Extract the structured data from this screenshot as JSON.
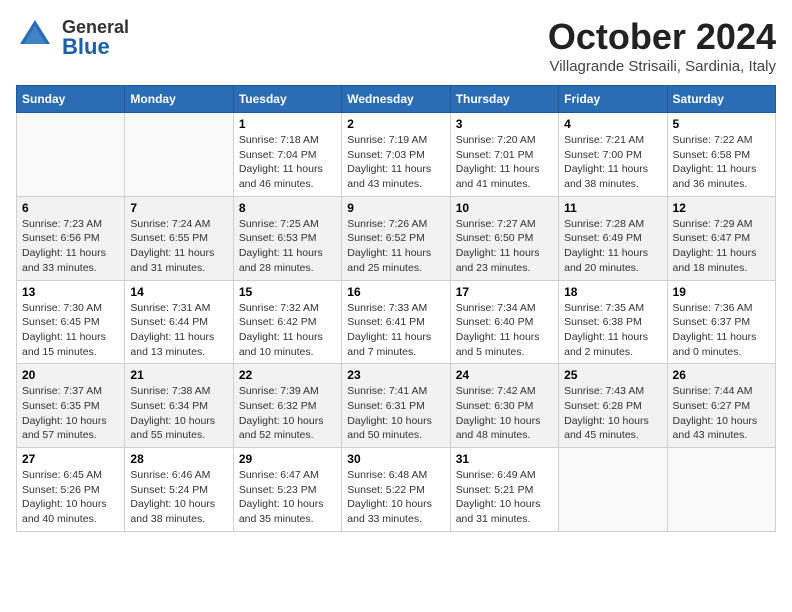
{
  "header": {
    "logo_general": "General",
    "logo_blue": "Blue",
    "month_title": "October 2024",
    "subtitle": "Villagrande Strisaili, Sardinia, Italy"
  },
  "days_of_week": [
    "Sunday",
    "Monday",
    "Tuesday",
    "Wednesday",
    "Thursday",
    "Friday",
    "Saturday"
  ],
  "weeks": [
    [
      {
        "day": "",
        "info": ""
      },
      {
        "day": "",
        "info": ""
      },
      {
        "day": "1",
        "info": "Sunrise: 7:18 AM\nSunset: 7:04 PM\nDaylight: 11 hours and 46 minutes."
      },
      {
        "day": "2",
        "info": "Sunrise: 7:19 AM\nSunset: 7:03 PM\nDaylight: 11 hours and 43 minutes."
      },
      {
        "day": "3",
        "info": "Sunrise: 7:20 AM\nSunset: 7:01 PM\nDaylight: 11 hours and 41 minutes."
      },
      {
        "day": "4",
        "info": "Sunrise: 7:21 AM\nSunset: 7:00 PM\nDaylight: 11 hours and 38 minutes."
      },
      {
        "day": "5",
        "info": "Sunrise: 7:22 AM\nSunset: 6:58 PM\nDaylight: 11 hours and 36 minutes."
      }
    ],
    [
      {
        "day": "6",
        "info": "Sunrise: 7:23 AM\nSunset: 6:56 PM\nDaylight: 11 hours and 33 minutes."
      },
      {
        "day": "7",
        "info": "Sunrise: 7:24 AM\nSunset: 6:55 PM\nDaylight: 11 hours and 31 minutes."
      },
      {
        "day": "8",
        "info": "Sunrise: 7:25 AM\nSunset: 6:53 PM\nDaylight: 11 hours and 28 minutes."
      },
      {
        "day": "9",
        "info": "Sunrise: 7:26 AM\nSunset: 6:52 PM\nDaylight: 11 hours and 25 minutes."
      },
      {
        "day": "10",
        "info": "Sunrise: 7:27 AM\nSunset: 6:50 PM\nDaylight: 11 hours and 23 minutes."
      },
      {
        "day": "11",
        "info": "Sunrise: 7:28 AM\nSunset: 6:49 PM\nDaylight: 11 hours and 20 minutes."
      },
      {
        "day": "12",
        "info": "Sunrise: 7:29 AM\nSunset: 6:47 PM\nDaylight: 11 hours and 18 minutes."
      }
    ],
    [
      {
        "day": "13",
        "info": "Sunrise: 7:30 AM\nSunset: 6:45 PM\nDaylight: 11 hours and 15 minutes."
      },
      {
        "day": "14",
        "info": "Sunrise: 7:31 AM\nSunset: 6:44 PM\nDaylight: 11 hours and 13 minutes."
      },
      {
        "day": "15",
        "info": "Sunrise: 7:32 AM\nSunset: 6:42 PM\nDaylight: 11 hours and 10 minutes."
      },
      {
        "day": "16",
        "info": "Sunrise: 7:33 AM\nSunset: 6:41 PM\nDaylight: 11 hours and 7 minutes."
      },
      {
        "day": "17",
        "info": "Sunrise: 7:34 AM\nSunset: 6:40 PM\nDaylight: 11 hours and 5 minutes."
      },
      {
        "day": "18",
        "info": "Sunrise: 7:35 AM\nSunset: 6:38 PM\nDaylight: 11 hours and 2 minutes."
      },
      {
        "day": "19",
        "info": "Sunrise: 7:36 AM\nSunset: 6:37 PM\nDaylight: 11 hours and 0 minutes."
      }
    ],
    [
      {
        "day": "20",
        "info": "Sunrise: 7:37 AM\nSunset: 6:35 PM\nDaylight: 10 hours and 57 minutes."
      },
      {
        "day": "21",
        "info": "Sunrise: 7:38 AM\nSunset: 6:34 PM\nDaylight: 10 hours and 55 minutes."
      },
      {
        "day": "22",
        "info": "Sunrise: 7:39 AM\nSunset: 6:32 PM\nDaylight: 10 hours and 52 minutes."
      },
      {
        "day": "23",
        "info": "Sunrise: 7:41 AM\nSunset: 6:31 PM\nDaylight: 10 hours and 50 minutes."
      },
      {
        "day": "24",
        "info": "Sunrise: 7:42 AM\nSunset: 6:30 PM\nDaylight: 10 hours and 48 minutes."
      },
      {
        "day": "25",
        "info": "Sunrise: 7:43 AM\nSunset: 6:28 PM\nDaylight: 10 hours and 45 minutes."
      },
      {
        "day": "26",
        "info": "Sunrise: 7:44 AM\nSunset: 6:27 PM\nDaylight: 10 hours and 43 minutes."
      }
    ],
    [
      {
        "day": "27",
        "info": "Sunrise: 6:45 AM\nSunset: 5:26 PM\nDaylight: 10 hours and 40 minutes."
      },
      {
        "day": "28",
        "info": "Sunrise: 6:46 AM\nSunset: 5:24 PM\nDaylight: 10 hours and 38 minutes."
      },
      {
        "day": "29",
        "info": "Sunrise: 6:47 AM\nSunset: 5:23 PM\nDaylight: 10 hours and 35 minutes."
      },
      {
        "day": "30",
        "info": "Sunrise: 6:48 AM\nSunset: 5:22 PM\nDaylight: 10 hours and 33 minutes."
      },
      {
        "day": "31",
        "info": "Sunrise: 6:49 AM\nSunset: 5:21 PM\nDaylight: 10 hours and 31 minutes."
      },
      {
        "day": "",
        "info": ""
      },
      {
        "day": "",
        "info": ""
      }
    ]
  ]
}
